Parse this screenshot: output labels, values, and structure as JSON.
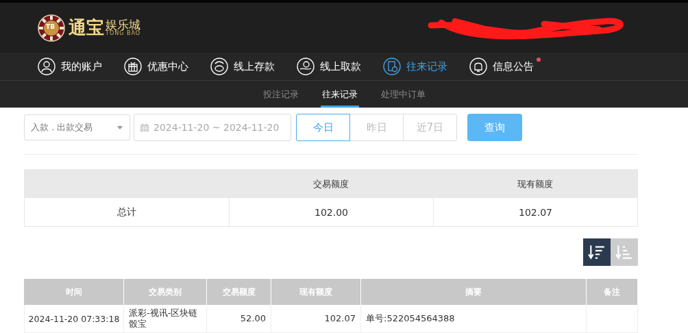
{
  "logo": {
    "title": "通宝",
    "subtitle": "娱乐城",
    "latin": "TONG BAO",
    "badge": "TB"
  },
  "nav": [
    {
      "label": "我的账户",
      "kind": "user",
      "selected": false,
      "badge": false
    },
    {
      "label": "优惠中心",
      "kind": "gift",
      "selected": false,
      "badge": false
    },
    {
      "label": "线上存款",
      "kind": "deposit",
      "selected": false,
      "badge": false
    },
    {
      "label": "线上取款",
      "kind": "withdraw",
      "selected": false,
      "badge": false
    },
    {
      "label": "往来记录",
      "kind": "records",
      "selected": true,
      "badge": false
    },
    {
      "label": "信息公告",
      "kind": "bell",
      "selected": false,
      "badge": true
    }
  ],
  "subtabs": [
    {
      "label": "投注记录",
      "selected": false
    },
    {
      "label": "往来记录",
      "selected": true
    },
    {
      "label": "处理中订单",
      "selected": false
    }
  ],
  "filters": {
    "type_select": "入款 . 出款交易",
    "date_range": "2024-11-20 ~ 2024-11-20",
    "ranges": [
      {
        "label": "今日",
        "selected": true
      },
      {
        "label": "昨日",
        "selected": false
      },
      {
        "label": "近7日",
        "selected": false
      }
    ],
    "query_button": "查询"
  },
  "summary": {
    "columns": [
      "交易额度",
      "现有额度"
    ],
    "row": {
      "label": "总计",
      "values": [
        "102.00",
        "102.07"
      ]
    }
  },
  "sort_buttons": [
    {
      "kind": "desc",
      "selected": true
    },
    {
      "kind": "asc",
      "selected": false
    }
  ],
  "table": {
    "columns": [
      "时间",
      "交易类别",
      "交易额度",
      "现有额度",
      "摘要",
      "备注"
    ],
    "rows": [
      [
        "2024-11-20 07:33:18",
        "派彩-视讯-区块链骰宝",
        "52.00",
        "102.07",
        "单号:522054564388",
        ""
      ]
    ]
  }
}
